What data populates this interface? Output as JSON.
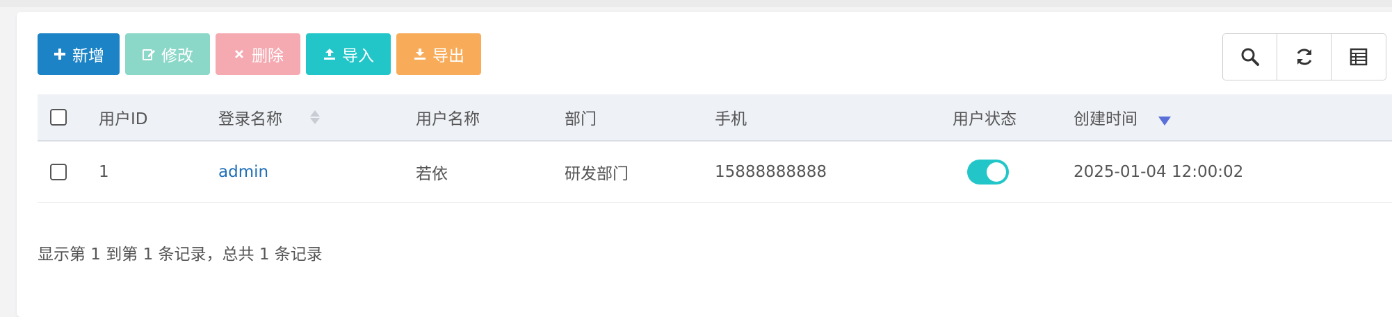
{
  "toolbar": {
    "add_label": "新增",
    "edit_label": "修改",
    "delete_label": "删除",
    "import_label": "导入",
    "export_label": "导出"
  },
  "table": {
    "columns": [
      "用户ID",
      "登录名称",
      "用户名称",
      "部门",
      "手机",
      "用户状态",
      "创建时间"
    ],
    "rows": [
      {
        "user_id": "1",
        "login_name": "admin",
        "user_name": "若依",
        "dept": "研发部门",
        "phone": "15888888888",
        "status_enabled": true,
        "created": "2025-01-04 12:00:02"
      }
    ]
  },
  "pagination": {
    "info": "显示第 1 到第 1 条记录，总共 1 条记录"
  },
  "colors": {
    "primary": "#1c84c6",
    "success": "#1ab394",
    "danger": "#ed5565",
    "info": "#23c6c8",
    "warning": "#f8ac59"
  },
  "icons": [
    "plus-icon",
    "edit-icon",
    "remove-icon",
    "upload-icon",
    "download-icon",
    "search-icon",
    "refresh-icon",
    "columns-icon"
  ]
}
